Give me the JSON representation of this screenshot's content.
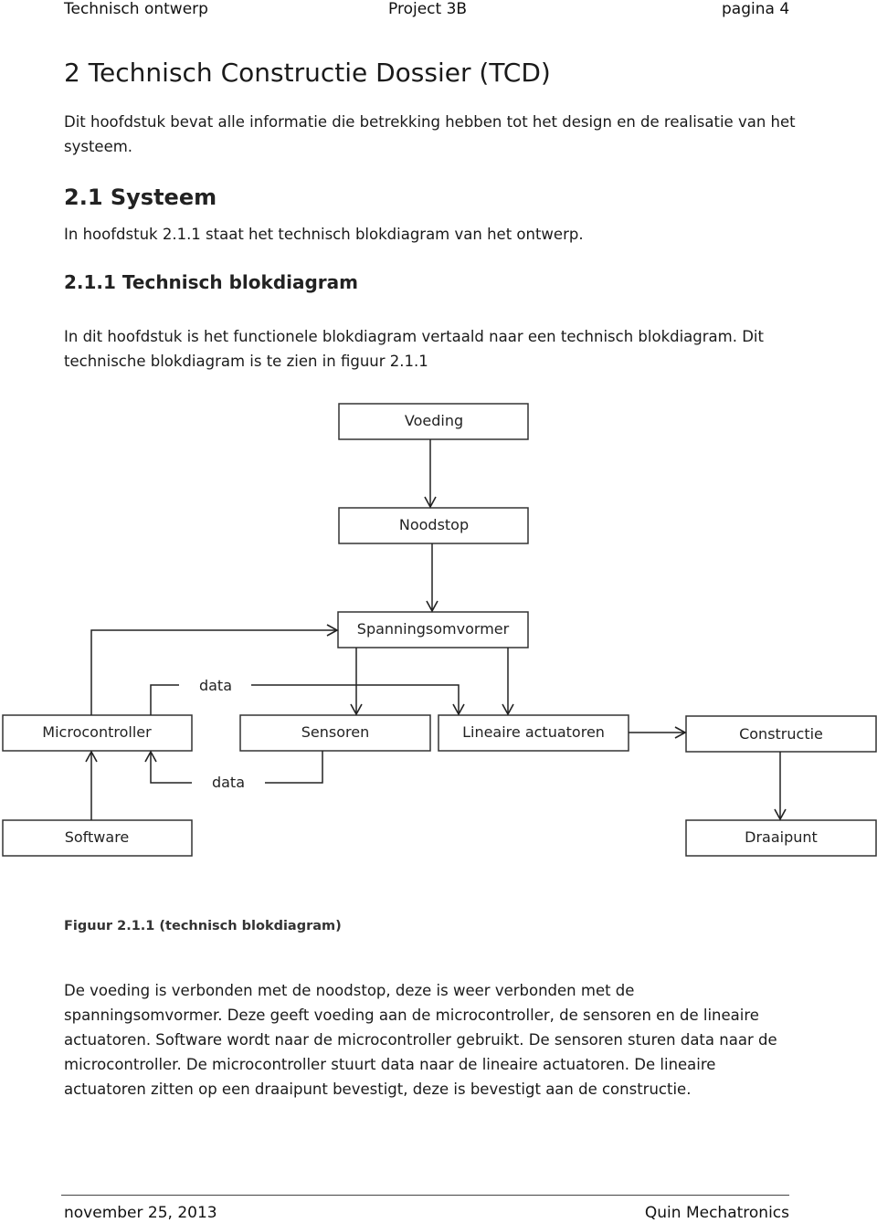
{
  "header": {
    "left": "Technisch ontwerp",
    "center": "Project 3B",
    "right": "pagina 4"
  },
  "chapter": {
    "title": "2  Technisch Constructie Dossier (TCD)",
    "intro": "Dit hoofdstuk bevat alle informatie die betrekking hebben tot het design en de realisatie van het systeem."
  },
  "section": {
    "title": "2.1  Systeem",
    "intro": "In hoofdstuk 2.1.1 staat het technisch blokdiagram van het ontwerp."
  },
  "subsection": {
    "title": "2.1.1  Technisch blokdiagram",
    "intro": "In dit hoofdstuk is het functionele blokdiagram vertaald naar een technisch blokdiagram. Dit technische blokdiagram is te zien in figuur 2.1.1"
  },
  "diagram": {
    "blocks": {
      "voeding": "Voeding",
      "noodstop": "Noodstop",
      "spanningsomvormer": "Spanningsomvormer",
      "microcontroller": "Microcontroller",
      "sensoren": "Sensoren",
      "lineaire_actuatoren": "Lineaire actuatoren",
      "constructie": "Constructie",
      "software": "Software",
      "draaipunt": "Draaipunt"
    },
    "edge_labels": {
      "data_out": "data",
      "data_in": "data"
    },
    "caption": "Figuur 2.1.1 (technisch blokdiagram)"
  },
  "body_text": "De voeding is verbonden met de noodstop, deze is weer verbonden met de spanningsomvormer. Deze geeft voeding aan de microcontroller, de sensoren en de lineaire actuatoren. Software wordt naar de microcontroller gebruikt. De sensoren sturen data naar de microcontroller. De microcontroller stuurt data naar de lineaire actuatoren. De lineaire actuatoren zitten op een draaipunt bevestigt, deze is bevestigt aan de constructie.",
  "footer": {
    "left": "november 25, 2013",
    "right": "Quin Mechatronics"
  }
}
